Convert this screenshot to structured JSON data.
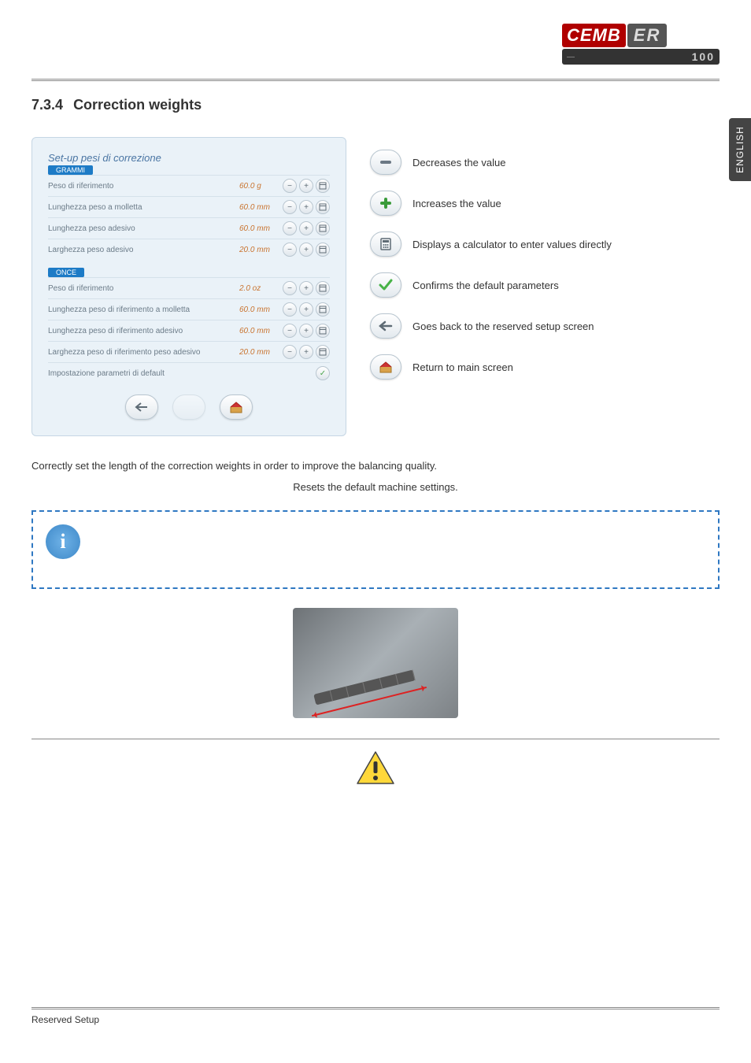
{
  "brand": {
    "name1": "CEMB",
    "name2": "ER",
    "subline_left": "—",
    "subline_model": "100"
  },
  "side_tab": "ENGLISH",
  "heading": {
    "number": "7.3.4",
    "title": "Correction weights"
  },
  "screenshot": {
    "title": "Set-up pesi di correzione",
    "unit1": "GRAMMI",
    "rows1": [
      {
        "label": "Peso di riferimento",
        "value": "60.0 g"
      },
      {
        "label": "Lunghezza peso a molletta",
        "value": "60.0 mm"
      },
      {
        "label": "Lunghezza peso adesivo",
        "value": "60.0 mm"
      },
      {
        "label": "Larghezza peso adesivo",
        "value": "20.0 mm"
      }
    ],
    "unit2": "ONCE",
    "rows2": [
      {
        "label": "Peso di riferimento",
        "value": "2.0 oz"
      },
      {
        "label": "Lunghezza peso di riferimento a molletta",
        "value": "60.0 mm"
      },
      {
        "label": "Lunghezza peso di riferimento adesivo",
        "value": "60.0 mm"
      },
      {
        "label": "Larghezza peso di riferimento peso adesivo",
        "value": "20.0 mm"
      }
    ],
    "default_row_label": "Impostazione parametri di default"
  },
  "legend": {
    "decrease": "Decreases the value",
    "increase": "Increases the value",
    "calculator": "Displays a calculator to enter values directly",
    "confirm": "Confirms the default parameters",
    "back": "Goes back to the reserved setup screen",
    "home": "Return to main screen"
  },
  "body_text": "Correctly set the length of the correction weights in order to improve the balancing quality.",
  "reset_text": "Resets the default machine settings.",
  "footer": "Reserved Setup"
}
